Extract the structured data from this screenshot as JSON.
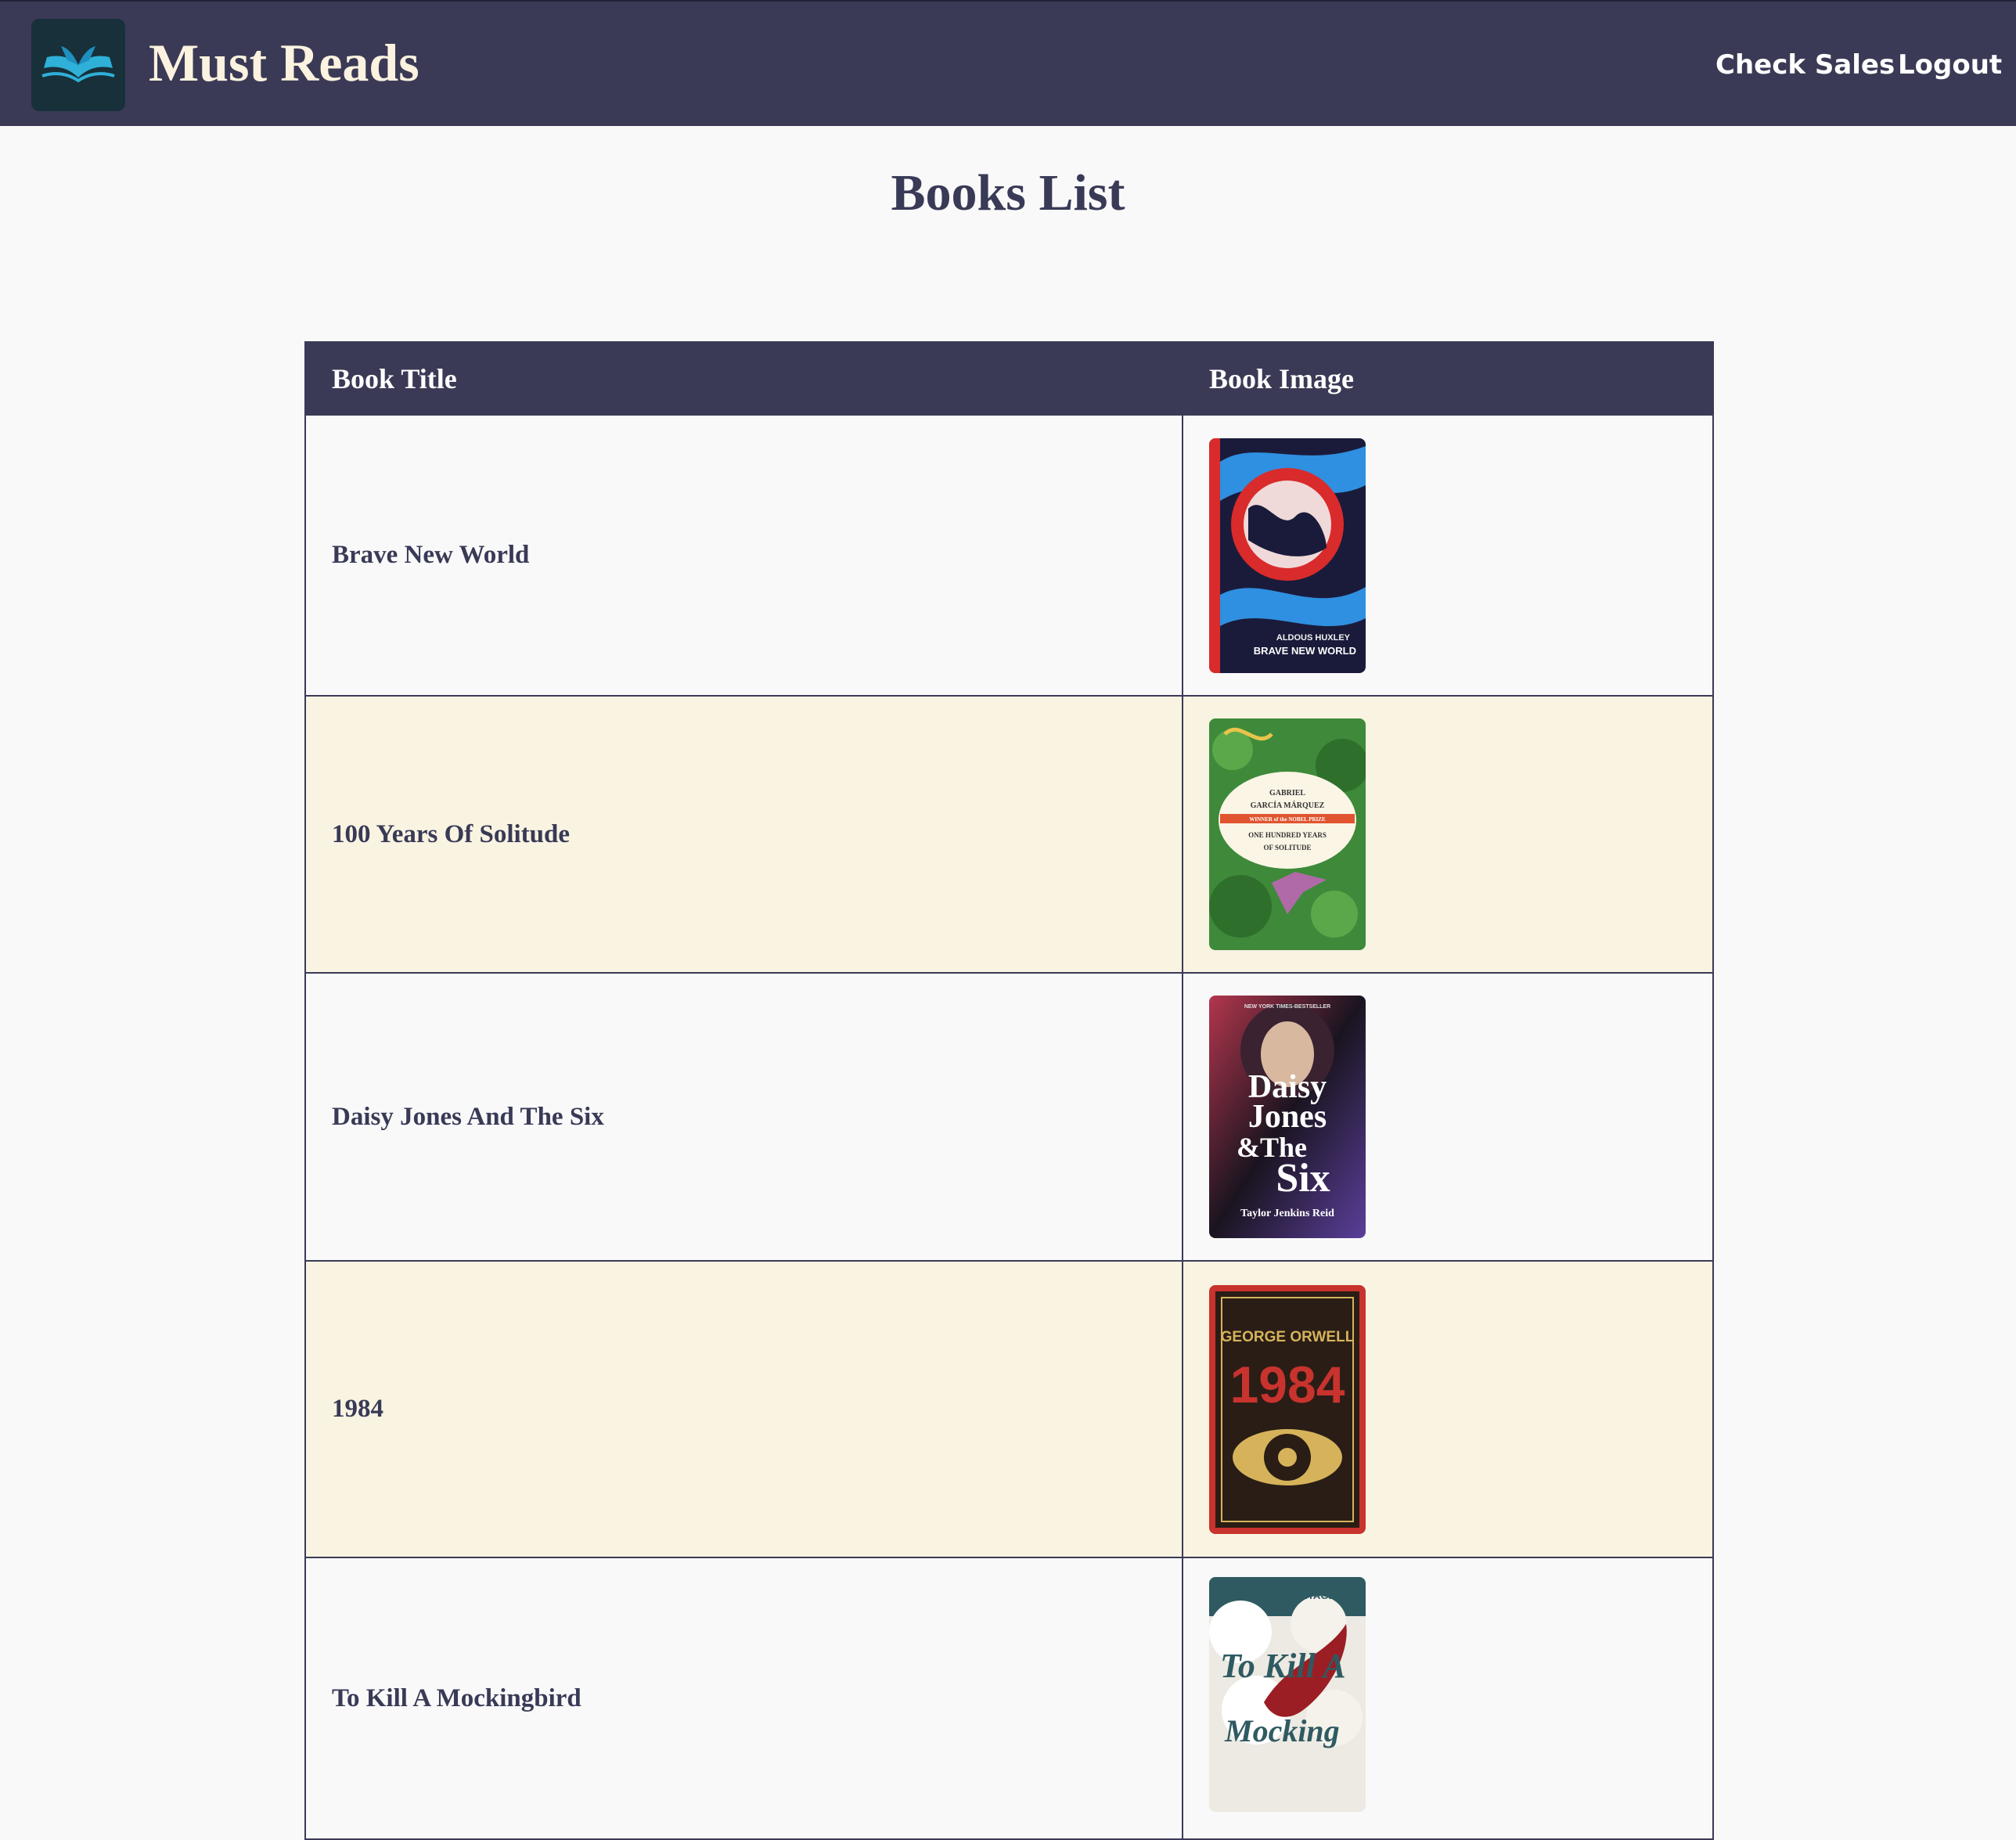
{
  "header": {
    "brand": "Must Reads",
    "logo_icon": "open-book-icon",
    "nav": [
      {
        "label": "Check Sales"
      },
      {
        "label": "Logout"
      }
    ]
  },
  "page": {
    "title": "Books List"
  },
  "table": {
    "columns": [
      "Book Title",
      "Book Image"
    ],
    "rows": [
      {
        "title": "Brave New World",
        "cover": {
          "author": "ALDOUS HUXLEY",
          "title": "BRAVE NEW WORLD",
          "colors": {
            "bg": "#1a1b3a",
            "accent": "#d92b2b",
            "wave": "#2f8fe0"
          }
        }
      },
      {
        "title": "100 Years Of Solitude",
        "cover": {
          "author_line1": "GABRIEL",
          "author_line2": "GARCÍA MÁRQUEZ",
          "banner": "WINNER of the NOBEL PRIZE",
          "title_line1": "ONE HUNDRED YEARS",
          "title_line2": "OF SOLITUDE",
          "colors": {
            "bg": "#3e8a3a",
            "accent": "#e0552f",
            "bird": "#b06aa8"
          }
        }
      },
      {
        "title": "Daisy Jones And The Six",
        "cover": {
          "tagline": "NEW YORK TIMES-BESTSELLER",
          "title_line1": "Daisy",
          "title_line2": "Jones",
          "title_line3": "&The",
          "title_line4": "Six",
          "author": "Taylor Jenkins Reid",
          "colors": {
            "bg": "#1a1420",
            "accent": "#b3364d",
            "glow": "#5a3f9a"
          }
        }
      },
      {
        "title": "1984",
        "cover": {
          "author": "GEORGE ORWELL",
          "title": "1984",
          "colors": {
            "bg": "#2a1d16",
            "accent": "#c8332d",
            "gold": "#d6b35a"
          }
        }
      },
      {
        "title": "To Kill A Mockingbird",
        "cover": {
          "publisher": "VINTAGE LEE",
          "title": "To Kill A",
          "title_partial": "Mocking",
          "colors": {
            "bg": "#eceae2",
            "accent": "#9b1e24",
            "leaf": "#2f5a62"
          }
        }
      }
    ]
  }
}
